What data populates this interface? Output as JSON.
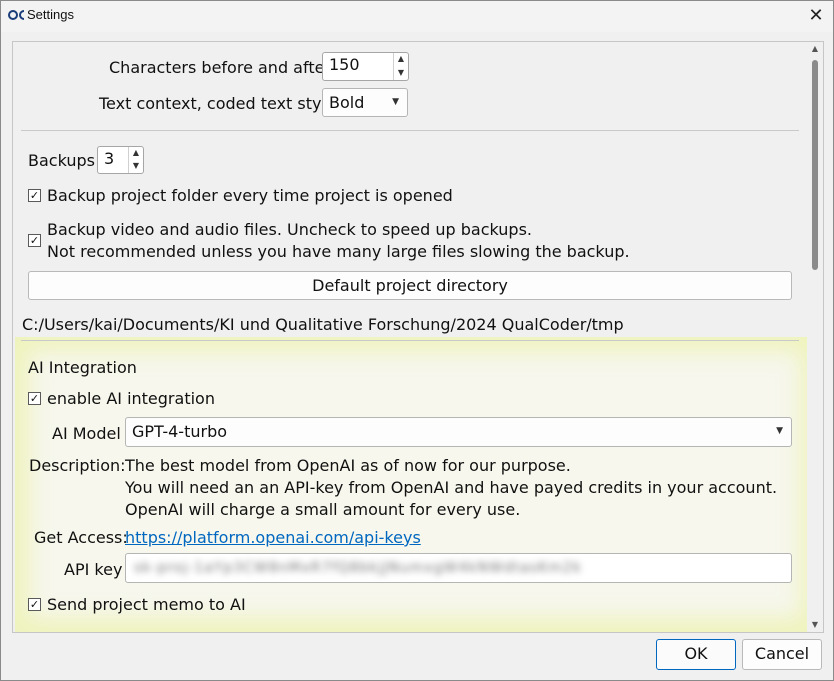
{
  "window": {
    "title": "Settings",
    "close_glyph": "✕"
  },
  "text_context": {
    "chars_label": "Characters before and after",
    "chars_value": "150",
    "style_label": "Text context, coded text style",
    "style_value": "Bold"
  },
  "backups": {
    "label": "Backups",
    "value": "3",
    "backup_on_open_label": "Backup project folder every time project is opened",
    "backup_on_open_checked": true,
    "backup_av_label_line1": "Backup video and audio files. Uncheck to speed up backups.",
    "backup_av_label_line2": "Not recommended unless you have many large files slowing the backup.",
    "backup_av_checked": true
  },
  "project_dir": {
    "button_label": "Default project directory",
    "path": "C:/Users/kai/Documents/KI und Qualitative Forschung/2024 QualCoder/tmp"
  },
  "ai": {
    "heading": "AI Integration",
    "enable_label": "enable AI integration",
    "enable_checked": true,
    "model_label": "AI Model",
    "model_value": "GPT-4-turbo",
    "description_label": "Description:",
    "description_line1": "The best model from OpenAI as of now for our purpose.",
    "description_line2": "You will need an an API-key from OpenAI and have payed credits in your account.",
    "description_line3": "OpenAI will charge a small amount for every use.",
    "access_label": "Get Access:",
    "access_link": "https://platform.openai.com/api-keys",
    "api_key_label": "API key",
    "api_key_value": "sk-proj-1aYp3CW8nMxR7fQ8bkjJNumxgW4kNWdtasKm2k",
    "send_memo_label": "Send project memo to AI",
    "send_memo_checked": true
  },
  "buttons": {
    "ok": "OK",
    "cancel": "Cancel"
  },
  "icons": {
    "check": "✓",
    "spin_up": "▲",
    "spin_down": "▼",
    "dropdown": "▼"
  }
}
